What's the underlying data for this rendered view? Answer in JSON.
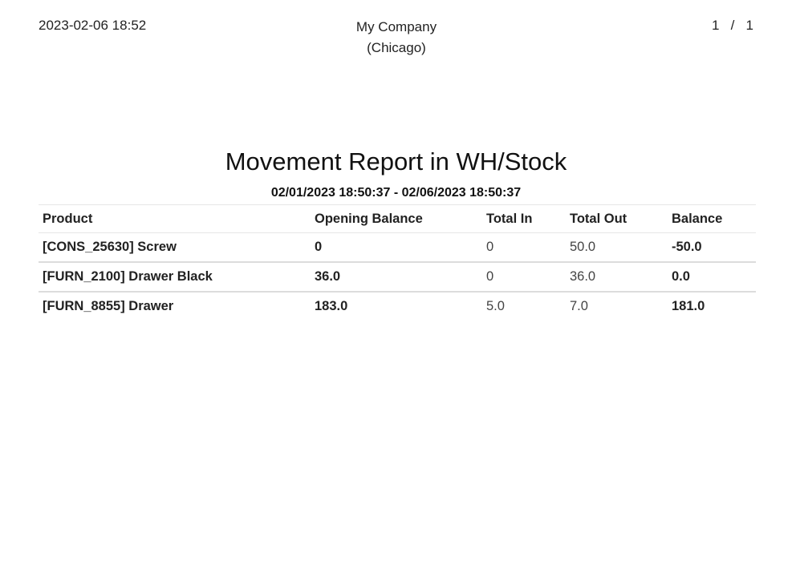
{
  "header": {
    "date": "2023-02-06 18:52",
    "company_name": "My Company",
    "company_location": "(Chicago)",
    "page_current": "1",
    "page_separator": "/",
    "page_total": "1"
  },
  "report": {
    "title": "Movement Report in WH/Stock",
    "date_range": "02/01/2023 18:50:37 - 02/06/2023 18:50:37",
    "columns": [
      "Product",
      "Opening Balance",
      "Total In",
      "Total Out",
      "Balance"
    ],
    "rows": [
      {
        "product": "[CONS_25630] Screw",
        "opening_balance": "0",
        "total_in": "0",
        "total_out": "50.0",
        "balance": "-50.0"
      },
      {
        "product": "[FURN_2100] Drawer Black",
        "opening_balance": "36.0",
        "total_in": "0",
        "total_out": "36.0",
        "balance": "0.0"
      },
      {
        "product": "[FURN_8855] Drawer",
        "opening_balance": "183.0",
        "total_in": "5.0",
        "total_out": "7.0",
        "balance": "181.0"
      }
    ]
  }
}
